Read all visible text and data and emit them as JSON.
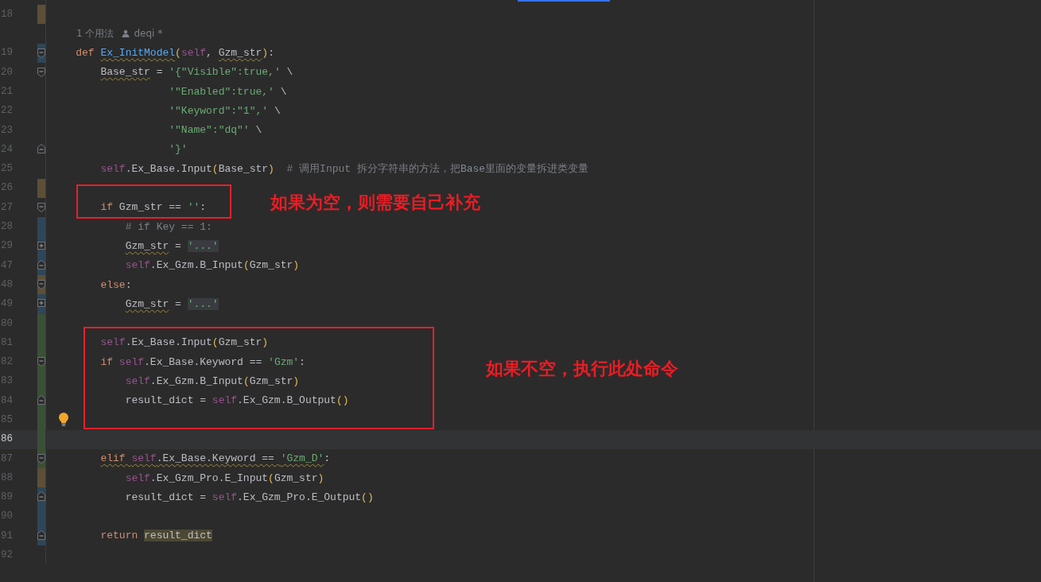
{
  "editor": {
    "lines": [
      {
        "kind": "code",
        "number": "18",
        "color": "#5c4f36",
        "current": false
      },
      {
        "kind": "hint",
        "usage": "1 个用法",
        "author": "deqi *"
      },
      {
        "kind": "code",
        "number": "19",
        "color": "#2e4658",
        "fold": {
          "kind": "start"
        },
        "current": false,
        "tokens": [
          {
            "t": "    def ",
            "kind": "kw",
            "wavy": false
          },
          {
            "t": "Ex_InitModel",
            "kind": "fn",
            "wavy": true
          },
          {
            "t": "(",
            "kind": "paren",
            "wavy": false
          },
          {
            "t": "self",
            "kind": "self",
            "wavy": false
          },
          {
            "t": ", ",
            "kind": "text",
            "wavy": false
          },
          {
            "t": "Gzm_str",
            "kind": "text",
            "wavy": true
          },
          {
            "t": ")",
            "kind": "paren",
            "wavy": false
          },
          {
            "t": ":",
            "kind": "text",
            "wavy": false
          }
        ]
      },
      {
        "kind": "code",
        "number": "20",
        "fold": {
          "kind": "start"
        },
        "current": false,
        "tokens": [
          {
            "t": "        Base_str",
            "kind": "text",
            "wavy": true
          },
          {
            "t": " = ",
            "kind": "text",
            "wavy": false
          },
          {
            "t": "'{\"Visible\":true,'",
            "kind": "str",
            "wavy": false
          },
          {
            "t": " \\",
            "kind": "text",
            "wavy": false
          }
        ]
      },
      {
        "kind": "code",
        "number": "21",
        "current": false,
        "tokens": [
          {
            "t": "                   '\"Enabled\":true,'",
            "kind": "str",
            "wavy": false
          },
          {
            "t": " \\",
            "kind": "text",
            "wavy": false
          }
        ]
      },
      {
        "kind": "code",
        "number": "22",
        "current": false,
        "tokens": [
          {
            "t": "                   '\"Keyword\":\"1\",'",
            "kind": "str",
            "wavy": false
          },
          {
            "t": " \\",
            "kind": "text",
            "wavy": false
          }
        ]
      },
      {
        "kind": "code",
        "number": "23",
        "current": false,
        "tokens": [
          {
            "t": "                   '\"Name\":\"dq\"'",
            "kind": "str",
            "wavy": false
          },
          {
            "t": " \\",
            "kind": "text",
            "wavy": false
          }
        ]
      },
      {
        "kind": "code",
        "number": "24",
        "fold": {
          "kind": "end"
        },
        "current": false,
        "tokens": [
          {
            "t": "                   '}'",
            "kind": "str",
            "wavy": false
          }
        ]
      },
      {
        "kind": "code",
        "number": "25",
        "current": false,
        "tokens": [
          {
            "t": "        self",
            "kind": "self",
            "wavy": false
          },
          {
            "t": ".Ex_Base.Input",
            "kind": "text",
            "wavy": false
          },
          {
            "t": "(",
            "kind": "paren",
            "wavy": false
          },
          {
            "t": "Base_str",
            "kind": "text",
            "wavy": false
          },
          {
            "t": ")",
            "kind": "paren",
            "wavy": false
          },
          {
            "t": "  # 调用Input 拆分字符串的方法，把",
            "kind": "comment",
            "wavy": false
          },
          {
            "t": "Base",
            "kind": "commentref",
            "wavy": false
          },
          {
            "t": "里面的变量拆进类变量",
            "kind": "comment",
            "wavy": false
          }
        ]
      },
      {
        "kind": "code",
        "number": "26",
        "color": "#5c4f36",
        "current": false
      },
      {
        "kind": "code",
        "number": "27",
        "fold": {
          "kind": "start"
        },
        "current": false,
        "tokens": [
          {
            "t": "        if ",
            "kind": "kw",
            "wavy": false
          },
          {
            "t": "Gzm_str == ",
            "kind": "text",
            "wavy": false
          },
          {
            "t": "''",
            "kind": "str",
            "wavy": false
          },
          {
            "t": ":",
            "kind": "text",
            "wavy": false
          }
        ]
      },
      {
        "kind": "code",
        "number": "28",
        "color": "#2e4658",
        "current": false,
        "tokens": [
          {
            "t": "            # if Key == 1:",
            "kind": "comment",
            "wavy": false
          }
        ]
      },
      {
        "kind": "code",
        "number": "29",
        "color": "#2e4658",
        "fold": {
          "kind": "collapsed"
        },
        "current": false,
        "tokens": [
          {
            "t": "            Gzm_str",
            "kind": "text",
            "wavy": true
          },
          {
            "t": " = ",
            "kind": "text",
            "wavy": false
          },
          {
            "t": "'...'",
            "kind": "folded",
            "wavy": false
          }
        ]
      },
      {
        "kind": "code",
        "number": "47",
        "color": "#2e4658",
        "fold": {
          "kind": "end"
        },
        "current": false,
        "tokens": [
          {
            "t": "            self",
            "kind": "self",
            "wavy": false
          },
          {
            "t": ".Ex_Gzm.B_Input",
            "kind": "text",
            "wavy": false
          },
          {
            "t": "(",
            "kind": "paren",
            "wavy": false
          },
          {
            "t": "Gzm_str",
            "kind": "text",
            "wavy": false
          },
          {
            "t": ")",
            "kind": "paren",
            "wavy": false
          }
        ]
      },
      {
        "kind": "code",
        "number": "48",
        "color": "#5c4f36",
        "fold": {
          "kind": "start"
        },
        "current": false,
        "tokens": [
          {
            "t": "        else",
            "kind": "kw",
            "wavy": false
          },
          {
            "t": ":",
            "kind": "text",
            "wavy": false
          }
        ]
      },
      {
        "kind": "code",
        "number": "49",
        "color": "#2e4658",
        "fold": {
          "kind": "collapsed"
        },
        "current": false,
        "tokens": [
          {
            "t": "            Gzm_str",
            "kind": "text",
            "wavy": true
          },
          {
            "t": " = ",
            "kind": "text",
            "wavy": false
          },
          {
            "t": "'...'",
            "kind": "folded",
            "wavy": false
          }
        ]
      },
      {
        "kind": "code",
        "number": "80",
        "color": "#3a5036",
        "current": false
      },
      {
        "kind": "code",
        "number": "81",
        "color": "#3a5036",
        "current": false,
        "tokens": [
          {
            "t": "        self",
            "kind": "self",
            "wavy": false
          },
          {
            "t": ".Ex_Base.Input",
            "kind": "text",
            "wavy": false
          },
          {
            "t": "(",
            "kind": "paren",
            "wavy": false
          },
          {
            "t": "Gzm_str",
            "kind": "text",
            "wavy": false
          },
          {
            "t": ")",
            "kind": "paren",
            "wavy": false
          }
        ]
      },
      {
        "kind": "code",
        "number": "82",
        "color": "#3a5036",
        "fold": {
          "kind": "start"
        },
        "current": false,
        "tokens": [
          {
            "t": "        if ",
            "kind": "kw",
            "wavy": false
          },
          {
            "t": "self",
            "kind": "self",
            "wavy": false
          },
          {
            "t": ".Ex_Base.Keyword == ",
            "kind": "text",
            "wavy": false
          },
          {
            "t": "'Gzm'",
            "kind": "str",
            "wavy": false
          },
          {
            "t": ":",
            "kind": "text",
            "wavy": false
          }
        ]
      },
      {
        "kind": "code",
        "number": "83",
        "color": "#3a5036",
        "current": false,
        "tokens": [
          {
            "t": "            self",
            "kind": "self",
            "wavy": false
          },
          {
            "t": ".Ex_Gzm.B_Input",
            "kind": "text",
            "wavy": false
          },
          {
            "t": "(",
            "kind": "paren",
            "wavy": false
          },
          {
            "t": "Gzm_str",
            "kind": "text",
            "wavy": false
          },
          {
            "t": ")",
            "kind": "paren",
            "wavy": false
          }
        ]
      },
      {
        "kind": "code",
        "number": "84",
        "color": "#3a5036",
        "fold": {
          "kind": "end"
        },
        "current": false,
        "tokens": [
          {
            "t": "            result_dict = ",
            "kind": "text",
            "wavy": false
          },
          {
            "t": "self",
            "kind": "self",
            "wavy": false
          },
          {
            "t": ".Ex_Gzm.B_Output",
            "kind": "text",
            "wavy": false
          },
          {
            "t": "()",
            "kind": "paren",
            "wavy": false
          }
        ]
      },
      {
        "kind": "code",
        "number": "85",
        "color": "#3a5036",
        "lightbulb": true,
        "current": false
      },
      {
        "kind": "code",
        "number": "86",
        "color": "#3a5036",
        "current": true
      },
      {
        "kind": "code",
        "number": "87",
        "color": "#3a5036",
        "fold": {
          "kind": "start"
        },
        "current": false,
        "tokens": [
          {
            "t": "        elif ",
            "kind": "kw",
            "wavy": true
          },
          {
            "t": "self",
            "kind": "self",
            "wavy": true
          },
          {
            "t": ".Ex_Base.Keyword == ",
            "kind": "text",
            "wavy": true
          },
          {
            "t": "'Gzm_D'",
            "kind": "str",
            "wavy": true
          },
          {
            "t": ":",
            "kind": "text",
            "wavy": false
          }
        ]
      },
      {
        "kind": "code",
        "number": "88",
        "color": "#5c4f36",
        "current": false,
        "tokens": [
          {
            "t": "            self",
            "kind": "self",
            "wavy": false
          },
          {
            "t": ".Ex_Gzm_Pro.E_Input",
            "kind": "text",
            "wavy": false
          },
          {
            "t": "(",
            "kind": "paren",
            "wavy": false
          },
          {
            "t": "Gzm_str",
            "kind": "text",
            "wavy": false
          },
          {
            "t": ")",
            "kind": "paren",
            "wavy": false
          }
        ]
      },
      {
        "kind": "code",
        "number": "89",
        "color": "#2e4658",
        "fold": {
          "kind": "end"
        },
        "current": false,
        "tokens": [
          {
            "t": "            result_dict = ",
            "kind": "text",
            "wavy": false
          },
          {
            "t": "self",
            "kind": "self",
            "wavy": false
          },
          {
            "t": ".Ex_Gzm_Pro.E_Output",
            "kind": "text",
            "wavy": false
          },
          {
            "t": "()",
            "kind": "paren",
            "wavy": false
          }
        ]
      },
      {
        "kind": "code",
        "number": "90",
        "color": "#2e4658",
        "current": false
      },
      {
        "kind": "code",
        "number": "91",
        "color": "#2e4658",
        "fold": {
          "kind": "end"
        },
        "current": false,
        "tokens": [
          {
            "t": "        return ",
            "kind": "kw",
            "wavy": false
          },
          {
            "t": "result_dict",
            "kind": "hl",
            "wavy": false
          }
        ]
      },
      {
        "kind": "code",
        "number": "92",
        "current": false
      }
    ]
  },
  "annotations": [
    {
      "text": "如果为空，则需要自己补充"
    },
    {
      "text": "如果不空，执行此处命令"
    }
  ]
}
